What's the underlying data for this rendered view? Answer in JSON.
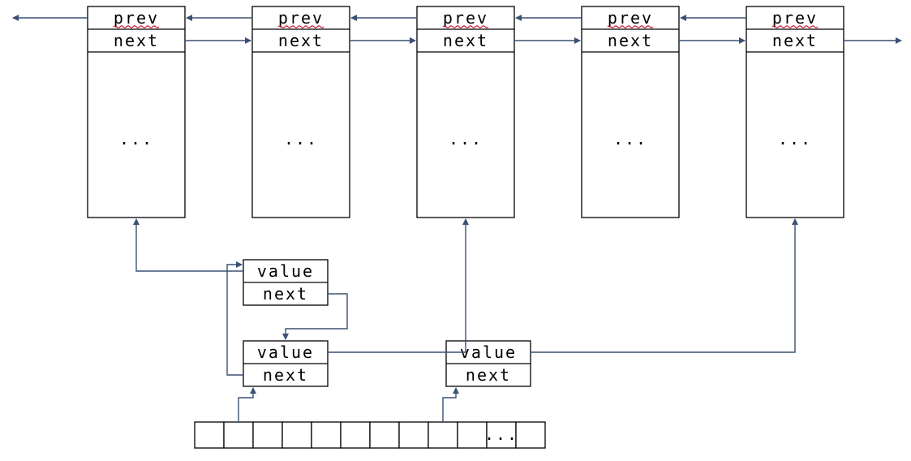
{
  "bigNodes": {
    "fields": [
      "prev",
      "next"
    ],
    "ellipsis": "...",
    "count": 5
  },
  "smallNodes": {
    "fields": [
      "value",
      "next"
    ],
    "count": 3
  },
  "hashArray": {
    "cells": 12,
    "ellipsis": "..."
  },
  "colors": {
    "arrow": "#3b5174",
    "squiggle": "#c8102e"
  }
}
